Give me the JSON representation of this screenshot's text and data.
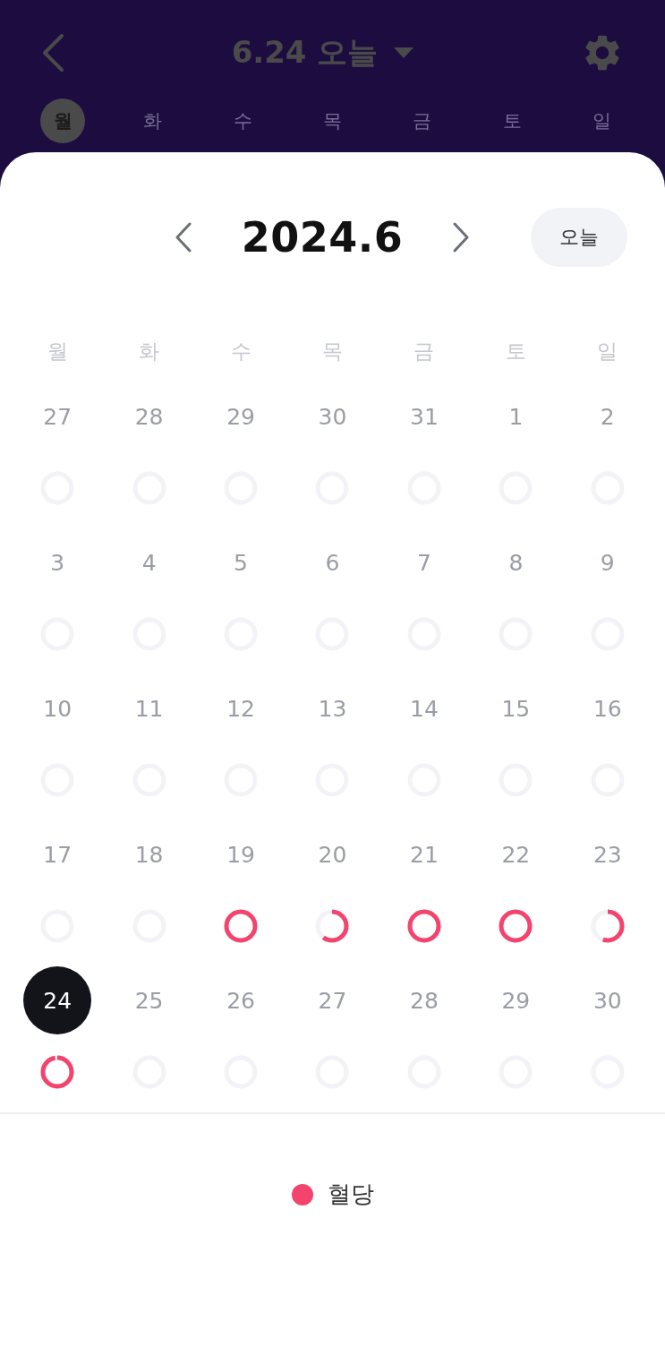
{
  "header": {
    "title": "6.24 오늘",
    "weekdays": [
      {
        "label": "월",
        "selected": true
      },
      {
        "label": "화",
        "selected": false
      },
      {
        "label": "수",
        "selected": false
      },
      {
        "label": "목",
        "selected": false
      },
      {
        "label": "금",
        "selected": false
      },
      {
        "label": "토",
        "selected": false
      },
      {
        "label": "일",
        "selected": false
      }
    ]
  },
  "calendar": {
    "month": "2024.6",
    "today_button": "오늘",
    "weekdays": [
      "월",
      "화",
      "수",
      "목",
      "금",
      "토",
      "일"
    ],
    "weeks": [
      [
        {
          "day": "27",
          "selected": false
        },
        {
          "day": "28",
          "selected": false
        },
        {
          "day": "29",
          "selected": false
        },
        {
          "day": "30",
          "selected": false
        },
        {
          "day": "31",
          "selected": false
        },
        {
          "day": "1",
          "selected": false
        },
        {
          "day": "2",
          "selected": false
        }
      ],
      [
        {
          "day": "3",
          "selected": false
        },
        {
          "day": "4",
          "selected": false
        },
        {
          "day": "5",
          "selected": false
        },
        {
          "day": "6",
          "selected": false
        },
        {
          "day": "7",
          "selected": false
        },
        {
          "day": "8",
          "selected": false
        },
        {
          "day": "9",
          "selected": false
        }
      ],
      [
        {
          "day": "10",
          "selected": false
        },
        {
          "day": "11",
          "selected": false
        },
        {
          "day": "12",
          "selected": false
        },
        {
          "day": "13",
          "selected": false
        },
        {
          "day": "14",
          "selected": false
        },
        {
          "day": "15",
          "selected": false
        },
        {
          "day": "16",
          "selected": false
        }
      ],
      [
        {
          "day": "17",
          "selected": false
        },
        {
          "day": "18",
          "selected": false
        },
        {
          "day": "19",
          "selected": false
        },
        {
          "day": "20",
          "selected": false
        },
        {
          "day": "21",
          "selected": false
        },
        {
          "day": "22",
          "selected": false
        },
        {
          "day": "23",
          "selected": false
        }
      ],
      [
        {
          "day": "24",
          "selected": true
        },
        {
          "day": "25",
          "selected": false
        },
        {
          "day": "26",
          "selected": false
        },
        {
          "day": "27",
          "selected": false
        },
        {
          "day": "28",
          "selected": false
        },
        {
          "day": "29",
          "selected": false
        },
        {
          "day": "30",
          "selected": false
        }
      ]
    ]
  },
  "legend": [
    {
      "label": "혈당",
      "color": "#f4436c"
    }
  ]
}
